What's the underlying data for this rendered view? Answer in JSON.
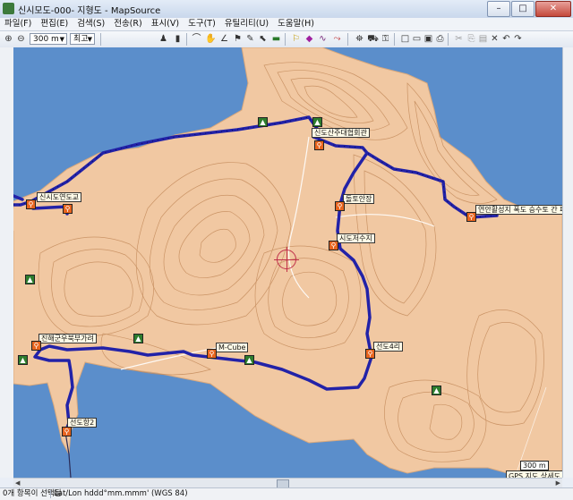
{
  "window": {
    "title": "신시모도-000- 지형도 - MapSource",
    "controls": [
      "–",
      "□",
      "✕"
    ]
  },
  "menu": [
    "파일(F)",
    "편집(E)",
    "검색(S)",
    "전송(R)",
    "표시(V)",
    "도구(T)",
    "유틸리티(U)",
    "도움말(H)"
  ],
  "toolbar": {
    "zoom_value": "300 m",
    "detail_value": "최고",
    "icons": [
      "zoom-in-icon",
      "zoom-out-icon",
      "binoculars-icon",
      "gear-icon",
      "close-icon",
      "undo-icon",
      "redo-icon"
    ]
  },
  "map": {
    "labels": {
      "bridge": "신시도연도교",
      "rest_area": "신도산주대협회관",
      "rest2": "돌토안장",
      "east": "연안활성지 폭도 승수토 간 패면",
      "center": "시도저수지",
      "mcube": "M-Cube",
      "southeast": "선도4리",
      "west_a": "진해군우북부가려",
      "southwest": "선도항2"
    },
    "scale_text": "300 m",
    "footer_text": "GPS 지도 상세도"
  },
  "status": {
    "selection": "0개 항목이 선택됨",
    "coords": "Lat/Lon hddd°mm.mmm' (WGS 84)"
  },
  "colors": {
    "sea": "#5b8ecb",
    "land": "#f1c8a2",
    "contour": "#c48b5c",
    "track": "#2222a8"
  }
}
